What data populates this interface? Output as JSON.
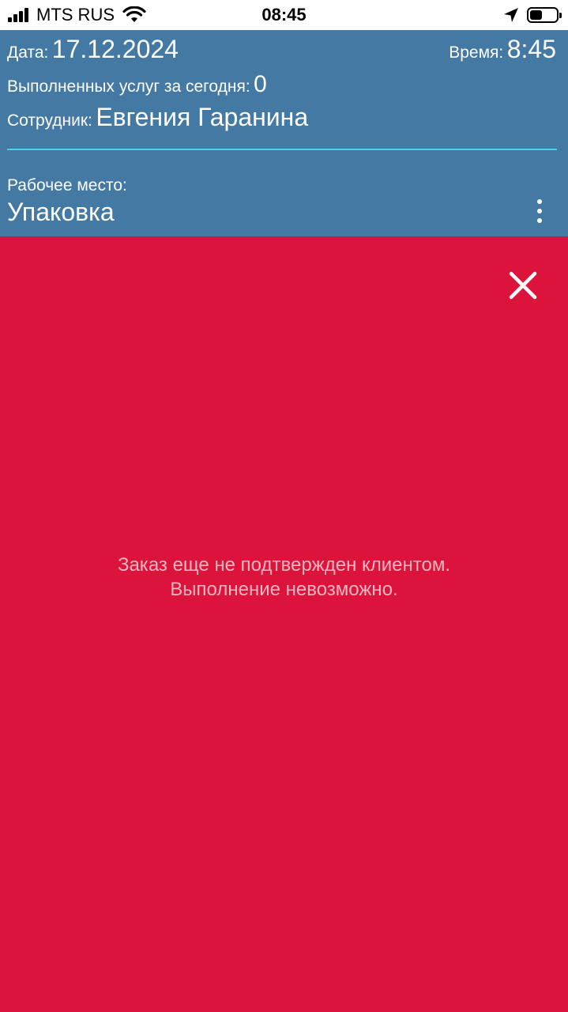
{
  "status_bar": {
    "carrier": "MTS RUS",
    "time": "08:45",
    "icons": [
      "signal-icon",
      "wifi-icon",
      "location-arrow-icon",
      "battery-icon"
    ]
  },
  "header": {
    "date_label": "Дата:",
    "date_value": "17.12.2024",
    "time_label": "Время:",
    "time_value": "8:45",
    "services_label": "Выполненных услуг за сегодня:",
    "services_value": "0",
    "employee_label": "Сотрудник:",
    "employee_value": "Евгения Гаранина",
    "workplace_label": "Рабочее место:",
    "workplace_value": "Упаковка",
    "menu_icon": "more-vertical-icon"
  },
  "error": {
    "close_icon": "close-icon",
    "line1": "Заказ еще не подтвержден клиентом.",
    "line2": "Выполнение невозможно."
  },
  "colors": {
    "header_bg": "#4479a4",
    "divider": "#46d4e8",
    "error_bg": "#dc143c",
    "error_text": "#f6b6c2"
  }
}
